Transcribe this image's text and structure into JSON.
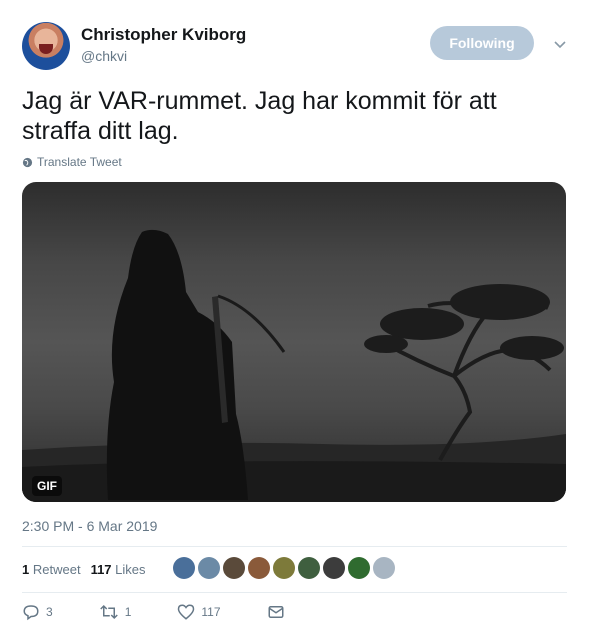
{
  "user": {
    "name": "Christopher Kviborg",
    "handle": "@chkvi"
  },
  "follow_button": {
    "label": "Following"
  },
  "tweet": {
    "text": "Jag är VAR-rummet. Jag har kommit för att straffa ditt lag.",
    "translate_label": "Translate Tweet"
  },
  "media": {
    "badge": "GIF"
  },
  "timestamp": "2:30 PM - 6 Mar 2019",
  "stats": {
    "retweets_count": "1",
    "retweets_label": "Retweet",
    "likes_count": "117",
    "likes_label": "Likes"
  },
  "likers": {
    "avatar_colors": [
      "#4a6f9a",
      "#6b8aa6",
      "#5a4a3a",
      "#8a5a3a",
      "#7d7a3a",
      "#3f5f3f",
      "#3c3c3c",
      "#2f6b2f",
      "#a8b5c2"
    ]
  },
  "actions": {
    "reply_count": "3",
    "retweet_count": "1",
    "like_count": "117"
  },
  "colors": {
    "follow_button_bg": "#b7c9da",
    "secondary_text": "#657786",
    "primary_text": "#14171a"
  }
}
